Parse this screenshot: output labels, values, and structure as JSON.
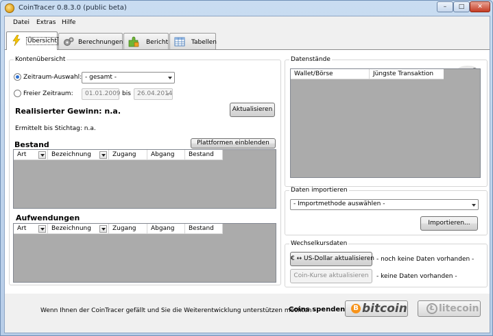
{
  "window": {
    "title": "CoinTracer 0.8.3.0 (public beta)",
    "min": "–",
    "max": "□",
    "close": "✕"
  },
  "menu": [
    "Datei",
    "Extras",
    "Hilfe"
  ],
  "tabs": [
    {
      "label": "Übersicht",
      "icon": "lightning-icon"
    },
    {
      "label": "Berechnungen",
      "icon": "gears-icon"
    },
    {
      "label": "Bericht",
      "icon": "puzzle-icon"
    },
    {
      "label": "Tabellen",
      "icon": "table-icon"
    }
  ],
  "konto": {
    "group_label": "Kontenübersicht",
    "radio_auswahl": "Zeitraum-Auswahl:",
    "auswahl_value": "- gesamt -",
    "radio_frei": "Freier Zeitraum:",
    "date_from": "01.01.2009",
    "bis": "bis",
    "date_to": "26.04.2014",
    "gewinn": "Realisierter Gewinn: n.a.",
    "aktualisieren": "Aktualisieren",
    "stichtag": "Ermittelt bis Stichtag: n.a."
  },
  "bestand": {
    "title": "Bestand",
    "platformen_button": "Plattformen einblenden",
    "columns": [
      "Art",
      "Bezeichnung",
      "Zugang",
      "Abgang",
      "Bestand"
    ]
  },
  "aufwendungen": {
    "title": "Aufwendungen",
    "columns": [
      "Art",
      "Bezeichnung",
      "Zugang",
      "Abgang",
      "Bestand"
    ]
  },
  "datenstaende": {
    "group_label": "Datenstände",
    "columns": [
      "Wallet/Börse",
      "Jüngste Transaktion"
    ]
  },
  "import": {
    "group_label": "Daten importieren",
    "method_value": "- Importmethode auswählen -",
    "button": "Importieren..."
  },
  "wechselkurs": {
    "group_label": "Wechselkursdaten",
    "usd_button": "€ ↔ US-Dollar aktualisieren",
    "usd_status": "- noch keine Daten vorhanden -",
    "coin_button": "Coin-Kurse aktualisieren",
    "coin_status": "- keine Daten vorhanden -"
  },
  "footer": {
    "message": "Wenn Ihnen der CoinTracer gefällt und Sie die Weiterentwicklung unterstützen möchten -",
    "spenden": "Coins spenden:",
    "bitcoin_symbol": "B",
    "bitcoin_word": "bitcoin",
    "litecoin_symbol": "Ł",
    "litecoin_word": "litecoin"
  },
  "colors": {
    "bitcoin_orange": "#f7931a",
    "grid_gray": "#ababab",
    "radio_blue": "#2b6fd0"
  }
}
